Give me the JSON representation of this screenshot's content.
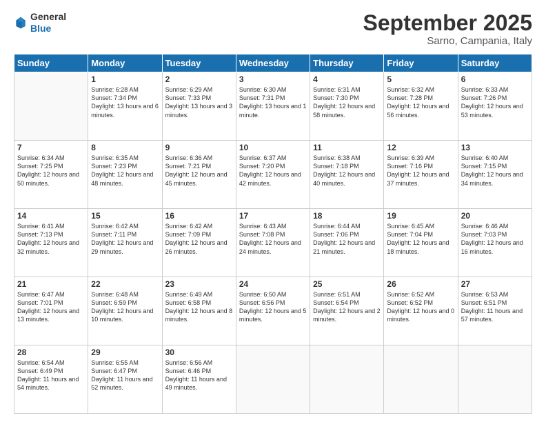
{
  "header": {
    "logo": {
      "general": "General",
      "blue": "Blue"
    },
    "title": "September 2025",
    "location": "Sarno, Campania, Italy"
  },
  "calendar": {
    "headers": [
      "Sunday",
      "Monday",
      "Tuesday",
      "Wednesday",
      "Thursday",
      "Friday",
      "Saturday"
    ],
    "weeks": [
      [
        {
          "day": "",
          "info": ""
        },
        {
          "day": "1",
          "info": "Sunrise: 6:28 AM\nSunset: 7:34 PM\nDaylight: 13 hours\nand 6 minutes."
        },
        {
          "day": "2",
          "info": "Sunrise: 6:29 AM\nSunset: 7:33 PM\nDaylight: 13 hours\nand 3 minutes."
        },
        {
          "day": "3",
          "info": "Sunrise: 6:30 AM\nSunset: 7:31 PM\nDaylight: 13 hours\nand 1 minute."
        },
        {
          "day": "4",
          "info": "Sunrise: 6:31 AM\nSunset: 7:30 PM\nDaylight: 12 hours\nand 58 minutes."
        },
        {
          "day": "5",
          "info": "Sunrise: 6:32 AM\nSunset: 7:28 PM\nDaylight: 12 hours\nand 56 minutes."
        },
        {
          "day": "6",
          "info": "Sunrise: 6:33 AM\nSunset: 7:26 PM\nDaylight: 12 hours\nand 53 minutes."
        }
      ],
      [
        {
          "day": "7",
          "info": "Sunrise: 6:34 AM\nSunset: 7:25 PM\nDaylight: 12 hours\nand 50 minutes."
        },
        {
          "day": "8",
          "info": "Sunrise: 6:35 AM\nSunset: 7:23 PM\nDaylight: 12 hours\nand 48 minutes."
        },
        {
          "day": "9",
          "info": "Sunrise: 6:36 AM\nSunset: 7:21 PM\nDaylight: 12 hours\nand 45 minutes."
        },
        {
          "day": "10",
          "info": "Sunrise: 6:37 AM\nSunset: 7:20 PM\nDaylight: 12 hours\nand 42 minutes."
        },
        {
          "day": "11",
          "info": "Sunrise: 6:38 AM\nSunset: 7:18 PM\nDaylight: 12 hours\nand 40 minutes."
        },
        {
          "day": "12",
          "info": "Sunrise: 6:39 AM\nSunset: 7:16 PM\nDaylight: 12 hours\nand 37 minutes."
        },
        {
          "day": "13",
          "info": "Sunrise: 6:40 AM\nSunset: 7:15 PM\nDaylight: 12 hours\nand 34 minutes."
        }
      ],
      [
        {
          "day": "14",
          "info": "Sunrise: 6:41 AM\nSunset: 7:13 PM\nDaylight: 12 hours\nand 32 minutes."
        },
        {
          "day": "15",
          "info": "Sunrise: 6:42 AM\nSunset: 7:11 PM\nDaylight: 12 hours\nand 29 minutes."
        },
        {
          "day": "16",
          "info": "Sunrise: 6:42 AM\nSunset: 7:09 PM\nDaylight: 12 hours\nand 26 minutes."
        },
        {
          "day": "17",
          "info": "Sunrise: 6:43 AM\nSunset: 7:08 PM\nDaylight: 12 hours\nand 24 minutes."
        },
        {
          "day": "18",
          "info": "Sunrise: 6:44 AM\nSunset: 7:06 PM\nDaylight: 12 hours\nand 21 minutes."
        },
        {
          "day": "19",
          "info": "Sunrise: 6:45 AM\nSunset: 7:04 PM\nDaylight: 12 hours\nand 18 minutes."
        },
        {
          "day": "20",
          "info": "Sunrise: 6:46 AM\nSunset: 7:03 PM\nDaylight: 12 hours\nand 16 minutes."
        }
      ],
      [
        {
          "day": "21",
          "info": "Sunrise: 6:47 AM\nSunset: 7:01 PM\nDaylight: 12 hours\nand 13 minutes."
        },
        {
          "day": "22",
          "info": "Sunrise: 6:48 AM\nSunset: 6:59 PM\nDaylight: 12 hours\nand 10 minutes."
        },
        {
          "day": "23",
          "info": "Sunrise: 6:49 AM\nSunset: 6:58 PM\nDaylight: 12 hours\nand 8 minutes."
        },
        {
          "day": "24",
          "info": "Sunrise: 6:50 AM\nSunset: 6:56 PM\nDaylight: 12 hours\nand 5 minutes."
        },
        {
          "day": "25",
          "info": "Sunrise: 6:51 AM\nSunset: 6:54 PM\nDaylight: 12 hours\nand 2 minutes."
        },
        {
          "day": "26",
          "info": "Sunrise: 6:52 AM\nSunset: 6:52 PM\nDaylight: 12 hours\nand 0 minutes."
        },
        {
          "day": "27",
          "info": "Sunrise: 6:53 AM\nSunset: 6:51 PM\nDaylight: 11 hours\nand 57 minutes."
        }
      ],
      [
        {
          "day": "28",
          "info": "Sunrise: 6:54 AM\nSunset: 6:49 PM\nDaylight: 11 hours\nand 54 minutes."
        },
        {
          "day": "29",
          "info": "Sunrise: 6:55 AM\nSunset: 6:47 PM\nDaylight: 11 hours\nand 52 minutes."
        },
        {
          "day": "30",
          "info": "Sunrise: 6:56 AM\nSunset: 6:46 PM\nDaylight: 11 hours\nand 49 minutes."
        },
        {
          "day": "",
          "info": ""
        },
        {
          "day": "",
          "info": ""
        },
        {
          "day": "",
          "info": ""
        },
        {
          "day": "",
          "info": ""
        }
      ]
    ]
  }
}
